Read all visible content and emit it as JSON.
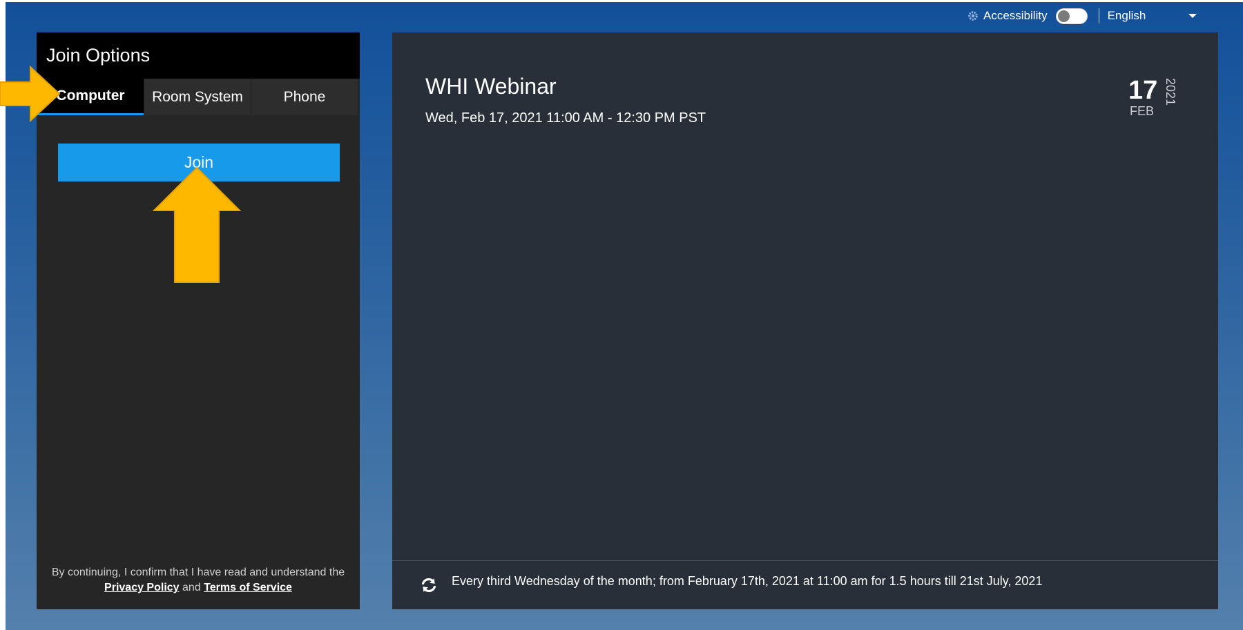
{
  "topbar": {
    "accessibility_label": "Accessibility",
    "language": "English"
  },
  "join_options": {
    "header": "Join Options",
    "tabs": [
      {
        "label": "Computer",
        "active": true
      },
      {
        "label": "Room System",
        "active": false
      },
      {
        "label": "Phone",
        "active": false
      }
    ],
    "join_label": "Join",
    "footer": {
      "text_before": "By continuing, I confirm that I have read and understand the",
      "privacy_link": "Privacy Policy",
      "and": "and",
      "terms_link": "Terms of Service"
    }
  },
  "meeting": {
    "title": "WHI Webinar",
    "datetime": "Wed, Feb 17, 2021 11:00 AM - 12:30 PM PST",
    "badge": {
      "day": "17",
      "month": "FEB",
      "year": "2021"
    },
    "recurrence": "Every third Wednesday of the month; from February 17th, 2021 at 11:00 am for 1.5 hours till 21st July, 2021"
  },
  "colors": {
    "accent": "#169ae9",
    "arrow": "#ffb800"
  }
}
